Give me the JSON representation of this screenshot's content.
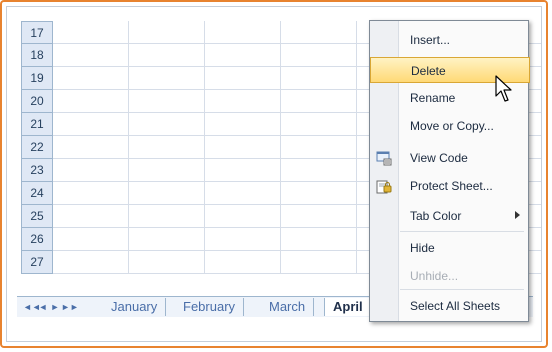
{
  "rows": [
    "17",
    "18",
    "19",
    "20",
    "21",
    "22",
    "23",
    "24",
    "25",
    "26",
    "27"
  ],
  "sheet_tabs": {
    "nav": [
      "◄◄",
      "◄",
      "►",
      "►►"
    ],
    "tabs": [
      "January",
      "February",
      "March",
      "April"
    ],
    "active": "April"
  },
  "context_menu": {
    "items": [
      {
        "label": "Insert...",
        "enabled": true
      },
      {
        "label": "Delete",
        "enabled": true,
        "highlighted": true
      },
      {
        "label": "Rename",
        "enabled": true
      },
      {
        "label": "Move or Copy...",
        "enabled": true
      },
      {
        "label": "View Code",
        "enabled": true,
        "icon": "view-code-icon"
      },
      {
        "label": "Protect Sheet...",
        "enabled": true,
        "icon": "protect-sheet-icon"
      },
      {
        "label": "Tab Color",
        "enabled": true,
        "submenu": true
      },
      {
        "label": "Hide",
        "enabled": true
      },
      {
        "label": "Unhide...",
        "enabled": false
      },
      {
        "label": "Select All Sheets",
        "enabled": true
      }
    ]
  },
  "colors": {
    "frame": "#e8832f",
    "highlight": "#ffd976",
    "header": "#dfe8f5"
  }
}
